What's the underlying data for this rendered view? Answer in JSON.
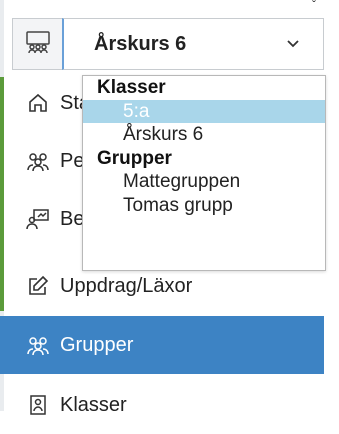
{
  "selector": {
    "value": "Årskurs 6",
    "options": {
      "groups": [
        {
          "label": "Klasser",
          "items": [
            "5:a",
            "Årskurs 6"
          ]
        },
        {
          "label": "Grupper",
          "items": [
            "Mattegruppen",
            "Tomas grupp"
          ]
        }
      ],
      "selected": "5:a"
    }
  },
  "sidebar": {
    "items": [
      {
        "label": "Start",
        "icon": "home-icon"
      },
      {
        "label": "Personer",
        "icon": "people-icon"
      },
      {
        "label": "Bedömning",
        "icon": "presentation-icon"
      },
      {
        "label": "Uppdrag/Läxor",
        "icon": "edit-icon"
      },
      {
        "label": "Grupper",
        "icon": "group-icon",
        "active": true
      },
      {
        "label": "Klasser",
        "icon": "class-icon"
      }
    ]
  },
  "colors": {
    "active_bg": "#3d83c4",
    "selected_option_bg": "#a9d6ea",
    "accent_green": "#5b9b3a"
  }
}
